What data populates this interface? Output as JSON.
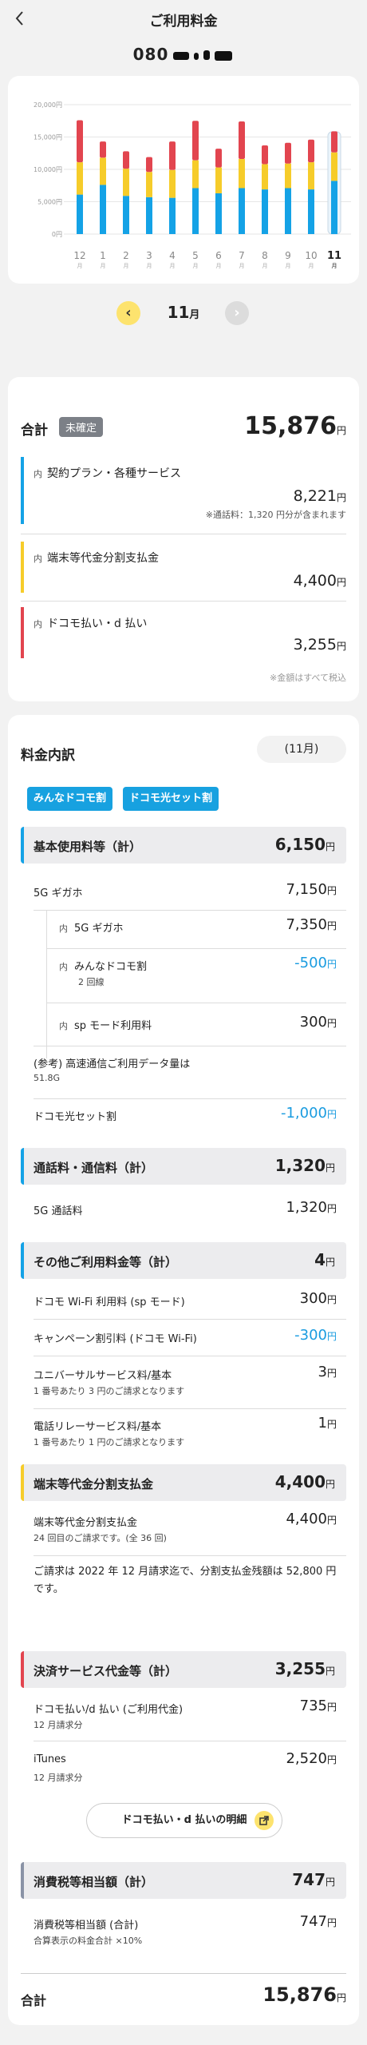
{
  "header": {
    "title": "ご利用料金",
    "phone_prefix": "080"
  },
  "chart": {
    "y_ticks": [
      "20,000円",
      "15,000円",
      "10,000円",
      "5,000円",
      "0円"
    ],
    "months": [
      "12",
      "1",
      "2",
      "3",
      "4",
      "5",
      "6",
      "7",
      "8",
      "9",
      "10",
      "11"
    ],
    "month_unit": "月",
    "colors": {
      "blue": "#14a2e6",
      "yellow": "#f6cc2a",
      "red": "#e2454f"
    }
  },
  "chart_data": {
    "type": "bar",
    "stacked": true,
    "categories": [
      "12",
      "1",
      "2",
      "3",
      "4",
      "5",
      "6",
      "7",
      "8",
      "9",
      "10",
      "11"
    ],
    "ylim": [
      0,
      20000
    ],
    "series": [
      {
        "values": [
          6100,
          7600,
          5900,
          5700,
          5600,
          7100,
          6300,
          7100,
          6900,
          7100,
          6900,
          8221
        ]
      },
      {
        "values": [
          5000,
          4200,
          4200,
          3900,
          4300,
          4300,
          4000,
          4500,
          3900,
          3800,
          4200,
          4400
        ]
      },
      {
        "values": [
          6500,
          2500,
          2700,
          2300,
          4400,
          6100,
          2900,
          5800,
          2900,
          3200,
          3500,
          3255
        ]
      }
    ]
  },
  "nav": {
    "month_label": "11",
    "month_unit": "月"
  },
  "summary": {
    "total_label": "合計",
    "status_badge": "未確定",
    "total_amount": "15,876",
    "yen": "円",
    "uchi": "内",
    "items": [
      {
        "name": "契約プラン・各種サービス",
        "amount": "8,221",
        "note": "※通話料：1,320 円分が含まれます",
        "color": "#14a2e6"
      },
      {
        "name": "端末等代金分割支払金",
        "amount": "4,400",
        "note": "",
        "color": "#f6cc2a"
      },
      {
        "name": "ドコモ払い・d 払い",
        "amount": "3,255",
        "note": "",
        "color": "#e2454f"
      }
    ],
    "tax_note": "※金額はすべて税込"
  },
  "detail": {
    "title": "料金内訳",
    "month_select": "(11月)",
    "tags": [
      "みんなドコモ割",
      "ドコモ光セット割"
    ],
    "sections": {
      "basic": {
        "name": "基本使用料等（計）",
        "amount": "6,150"
      },
      "call": {
        "name": "通話料・通信料（計）",
        "amount": "1,320"
      },
      "other": {
        "name": "その他ご利用料金等（計）",
        "amount": "4"
      },
      "device": {
        "name": "端末等代金分割支払金",
        "amount": "4,400"
      },
      "payment": {
        "name": "決済サービス代金等（計）",
        "amount": "3,255"
      },
      "tax": {
        "name": "消費税等相当額（計）",
        "amount": "747"
      }
    },
    "rows": {
      "giga": {
        "name": "5G ギガホ",
        "amount": "7,150"
      },
      "giga_sub": {
        "name": "5G ギガホ",
        "amount": "7,350"
      },
      "minna": {
        "name": "みんなドコモ割",
        "sub": "2 回線",
        "amount": "-500"
      },
      "spmode": {
        "name": "sp モード利用料",
        "amount": "300"
      },
      "data_ref": {
        "name": "(参考) 高速通信ご利用データ量は",
        "sub": "51.8G"
      },
      "hikari": {
        "name": "ドコモ光セット割",
        "amount": "-1,000"
      },
      "call5g": {
        "name": "5G 通話料",
        "amount": "1,320"
      },
      "wifi": {
        "name": "ドコモ Wi-Fi 利用料 (sp モード)",
        "amount": "300"
      },
      "campaign": {
        "name": "キャンペーン割引料 (ドコモ Wi-Fi)",
        "amount": "-300"
      },
      "universal": {
        "name": "ユニバーサルサービス料/基本",
        "sub": "1 番号あたり 3 円のご請求となります",
        "amount": "3"
      },
      "relay": {
        "name": "電話リレーサービス料/基本",
        "sub": "1 番号あたり 1 円のご請求となります",
        "amount": "1"
      },
      "device_pay": {
        "name": "端末等代金分割支払金",
        "sub": "24 回目のご請求です。(全 36 回)",
        "amount": "4,400"
      },
      "docomo_pay": {
        "name": "ドコモ払い/d 払い (ご利用代金)",
        "sub": "12 月請求分",
        "amount": "735"
      },
      "itunes": {
        "name": "iTunes",
        "sub": "12 月請求分",
        "amount": "2,520"
      },
      "tax_total": {
        "name": "消費税等相当額 (合計)",
        "sub": "合算表示の料金合計 ×10%",
        "amount": "747"
      }
    },
    "installment_info": "ご請求は 2022 年 12 月請求迄で、分割支払金残額は 52,800 円です。",
    "link_button": "ドコモ払い・d 払いの明細",
    "uchi": "内",
    "total_label": "合計",
    "total_amount": "15,876",
    "yen": "円"
  }
}
